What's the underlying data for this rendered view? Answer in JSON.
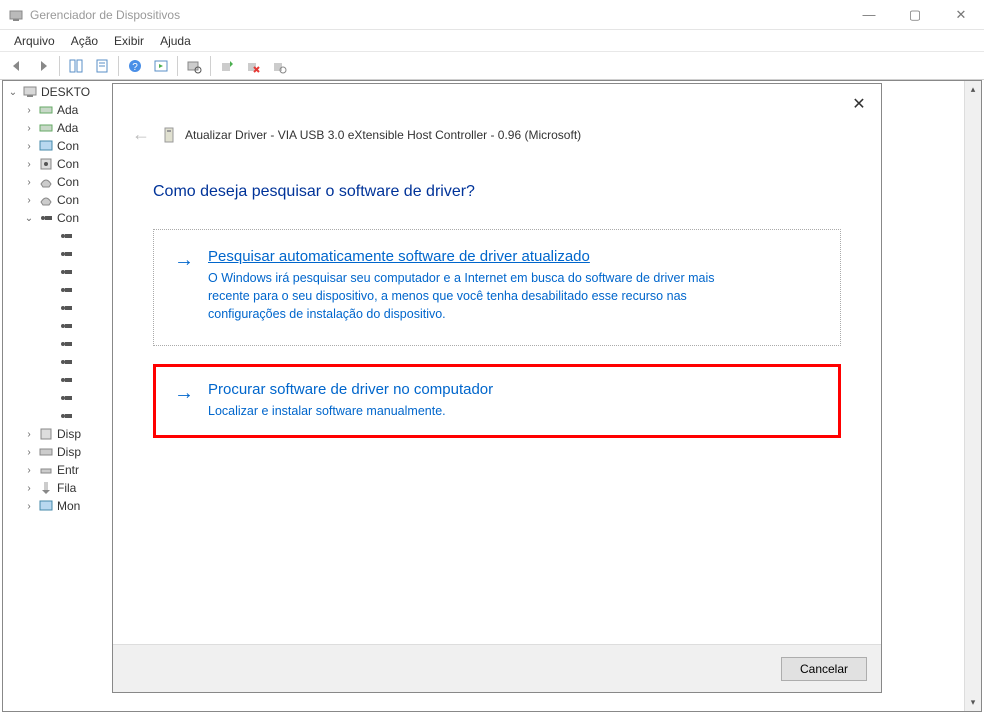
{
  "window": {
    "title": "Gerenciador de Dispositivos"
  },
  "menubar": {
    "arquivo": "Arquivo",
    "acao": "Ação",
    "exibir": "Exibir",
    "ajuda": "Ajuda"
  },
  "tree": {
    "root": "DESKTO",
    "items": [
      "Ada",
      "Ada",
      "Con",
      "Con",
      "Con",
      "Con",
      "Con"
    ],
    "usb_children_count": 11,
    "cut_items": [
      "Disp",
      "Disp",
      "Entr",
      "Fila",
      "Mon"
    ]
  },
  "dialog": {
    "title_prefix": "Atualizar Driver - ",
    "device_name": "VIA USB 3.0 eXtensible Host Controller - 0.96 (Microsoft)",
    "question": "Como deseja pesquisar o software de driver?",
    "option1": {
      "title": "Pesquisar automaticamente software de driver atualizado",
      "desc": "O Windows irá pesquisar seu computador e a Internet em busca do software de driver mais recente para o seu dispositivo, a menos que você tenha desabilitado esse recurso nas configurações de instalação do dispositivo."
    },
    "option2": {
      "title": "Procurar software de driver no computador",
      "desc": "Localizar e instalar software manualmente."
    },
    "cancel": "Cancelar"
  }
}
